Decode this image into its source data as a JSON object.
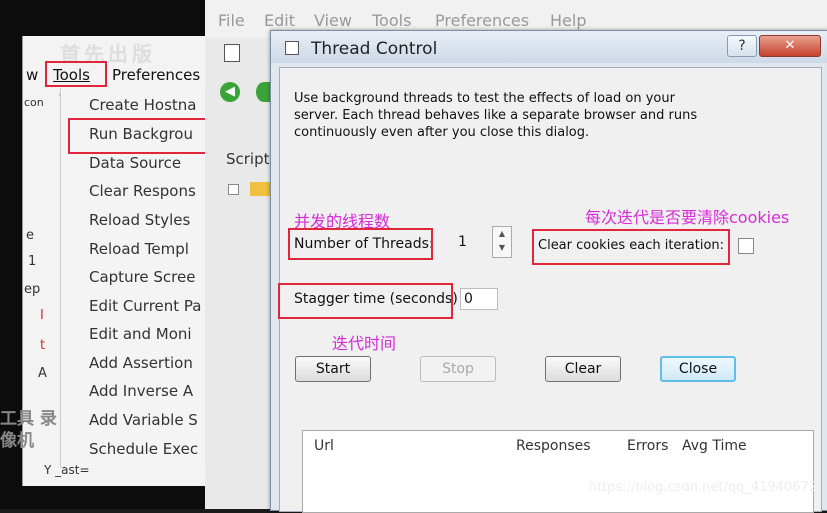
{
  "left_app": {
    "title_partial": "首先出版",
    "menubar": {
      "view": "w",
      "tools": "Tools",
      "preferences": "Preferences"
    },
    "side_fragments": [
      "con",
      "e",
      "1",
      "ep",
      "I",
      "t",
      "A"
    ],
    "overlay_text": "工具 录像机",
    "bottom_code": "Y _ast="
  },
  "tools_menu": {
    "items": [
      "Create Hostna",
      "Run Backgrou",
      "Data Source",
      "Clear Respons",
      "Reload Styles",
      "Reload Templ",
      "Capture Scree",
      "Edit Current Pa",
      "Edit and Moni",
      "Add Assertion",
      "Add Inverse A",
      "Add Variable S",
      "Schedule Exec"
    ]
  },
  "back_app": {
    "menubar": [
      "File",
      "Edit",
      "View",
      "Tools",
      "Preferences",
      "Help"
    ],
    "tree_label": "Script"
  },
  "dialog": {
    "title": "Thread Control",
    "help_label": "?",
    "close_label": "✕",
    "description": "Use background threads to test the effects of load on your server.  Each thread behaves like a separate browser and runs continuously even after you close this dialog.",
    "threads_label": "Number of Threads:",
    "threads_value": "1",
    "clear_cookies_label": "Clear cookies each iteration:",
    "stagger_label": "Stagger time (seconds)",
    "stagger_value": "0",
    "buttons": {
      "start": "Start",
      "stop": "Stop",
      "clear": "Clear",
      "close": "Close"
    },
    "table_headers": [
      "Url",
      "Responses",
      "Errors",
      "Avg Time"
    ]
  },
  "annotations": {
    "threads": "并发的线程数",
    "cookies": "每次迭代是否要清除cookies",
    "stagger": "迭代时间"
  },
  "watermark": "https://blog.csdn.net/qq_41940672",
  "colors": {
    "annotation": "#d62bd6",
    "highlight_box": "#e0263a",
    "focus_border": "#5ec0e8"
  }
}
